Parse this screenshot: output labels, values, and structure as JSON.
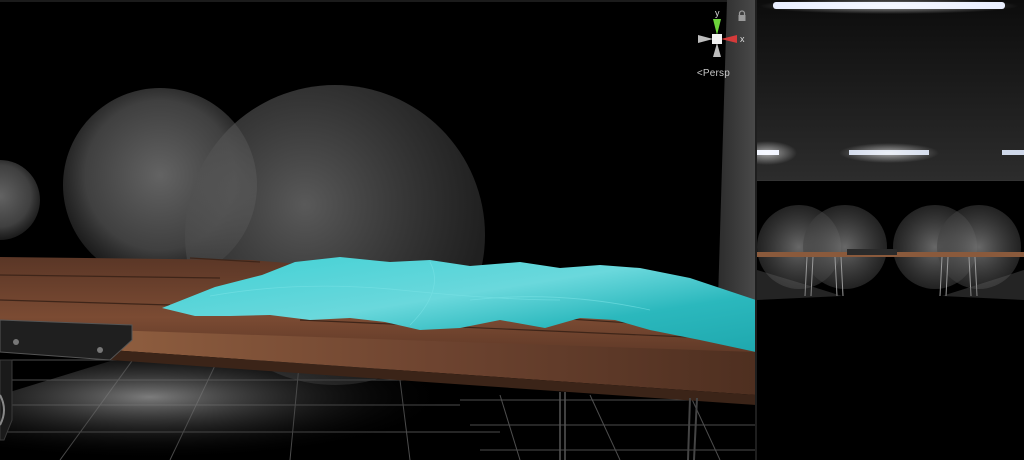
{
  "scene_view": {
    "gizmo": {
      "y_label": "y",
      "x_label": "x",
      "projection_label": "Persp",
      "projection_icon": "chevron-left-icon",
      "colors": {
        "y_axis": "#6cd43a",
        "x_axis": "#d43a3a",
        "neutral": "#bdbdbd"
      }
    },
    "lock_icon": "lock-icon",
    "colors": {
      "water": "#2ec4c9",
      "table_wood": "#6b4330",
      "table_edge": "#8a5a3c",
      "grid": "#4a4a4a",
      "floor": "#3a3a3a",
      "light_volume": "#6a6a6a"
    }
  },
  "game_view": {
    "colors": {
      "ceiling": "#2a2a2a",
      "ceiling_light": "#e8eeff",
      "tables": "#8a5a3c"
    }
  }
}
